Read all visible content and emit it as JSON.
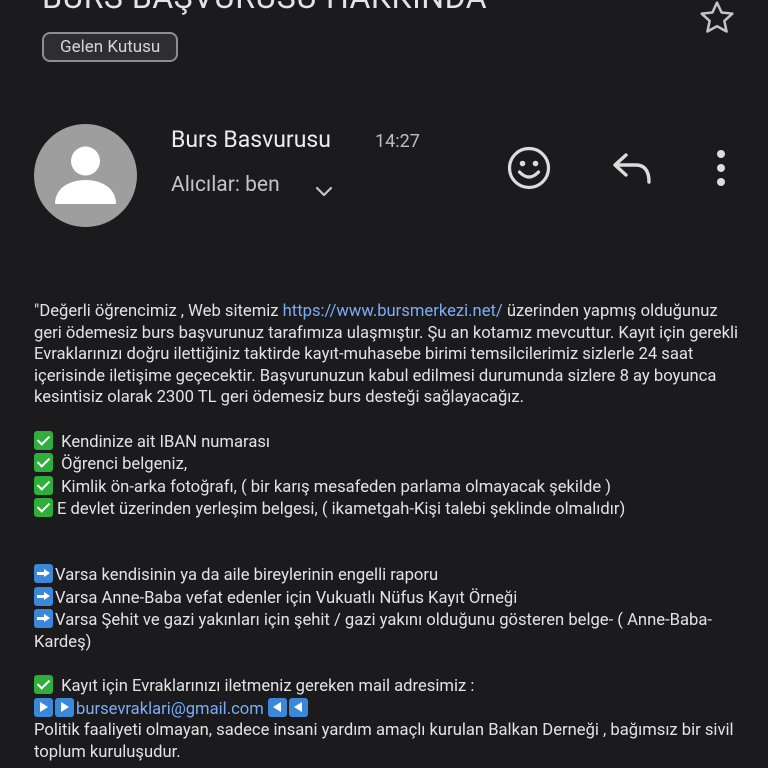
{
  "email": {
    "subject": "BURS BAŞVURUSU HAKKINDA",
    "label": "Gelen Kutusu",
    "sender": "Burs Basvurusu",
    "time": "14:27",
    "recipients": "Alıcılar: ben"
  },
  "icons": {
    "star": "star-outline-icon",
    "avatar": "person-icon",
    "recipients_toggle": "chevron-down-icon",
    "emoji": "smiley-face-icon",
    "reply": "reply-arrow-icon",
    "more": "more-vert-icon",
    "check": "check-mark-button-emoji",
    "arrow": "right-arrow-emoji",
    "play": "play-button-emoji",
    "reverse": "reverse-button-emoji"
  },
  "body": {
    "intro_pre": "\"Değerli öğrencimiz , Web sitemiz ",
    "intro_link": "https://www.bursmerkezi.net/",
    "intro_post": " üzerinden yapmış olduğunuz geri ödemesiz burs başvurunuz tarafımıza ulaşmıştır. Şu an kotamız mevcuttur. Kayıt için gerekli Evraklarınızı doğru ilettiğiniz taktirde kayıt-muhasebe birimi temsilcilerimiz sizlerle 24 saat içerisinde iletişime geçecektir. Başvurunuzun kabul edilmesi durumunda sizlere 8 ay boyunca kesintisiz olarak 2300 TL geri ödemesiz burs desteği sağlayacağız.",
    "checklist": [
      " Kendinize ait IBAN numarası",
      " Öğrenci belgeniz,",
      " Kimlik ön-arka fotoğrafı,  ( bir karış mesafeden parlama olmayacak şekilde )",
      "E devlet üzerinden yerleşim belgesi, ( ikametgah-Kişi talebi şeklinde olmalıdır)"
    ],
    "arrow_items": [
      "Varsa kendisinin ya da aile bireylerinin engelli raporu",
      "Varsa Anne-Baba vefat edenler için Vukuatlı Nüfus Kayıt Örneği",
      "Varsa Şehit ve gazi yakınları için şehit / gazi yakını olduğunu gösteren belge- ( Anne-Baba-Kardeş)"
    ],
    "mail_line": " Kayıt için Evraklarınızı iletmeniz gereken mail adresimiz :",
    "mail_address": "bursevraklari@gmail.com",
    "footer": "Politik faaliyeti olmayan, sadece insani yardım amaçlı kurulan Balkan Derneği , bağımsız bir sivil toplum kuruluşudur."
  },
  "colors": {
    "background": "#1b1b1d",
    "link": "#7cacf8",
    "avatar": "#9e9e9e",
    "text": "#e3e3e3"
  }
}
